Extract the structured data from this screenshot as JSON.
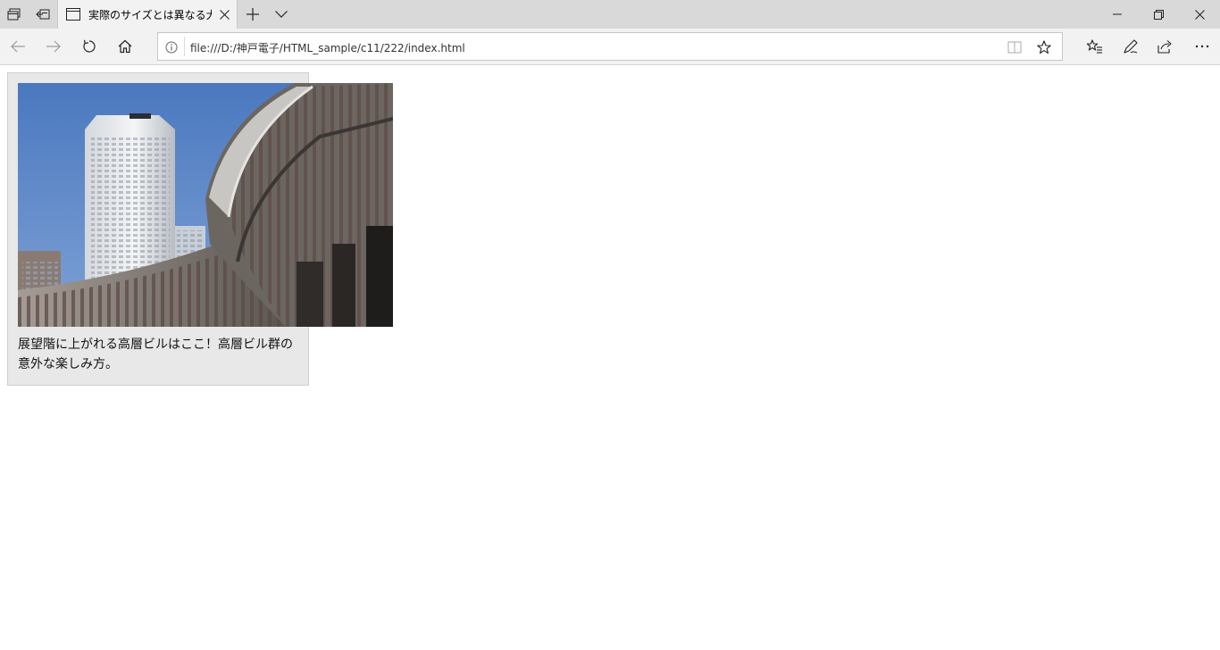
{
  "browser": {
    "tab": {
      "title": "実際のサイズとは異なる大"
    },
    "address": {
      "url": "file:///D:/神戸電子/HTML_sample/c11/222/index.html"
    },
    "icons": {
      "tab_manager": "tab-manager-icon",
      "set_aside": "set-aside-tabs-icon",
      "tab_page": "page-icon",
      "close_tab": "close-icon",
      "new_tab": "plus-icon",
      "tab_preview": "chevron-down-icon",
      "minimize": "minimize-icon",
      "restore": "restore-icon",
      "close_window": "close-icon",
      "back": "back-arrow-icon",
      "forward": "forward-arrow-icon",
      "refresh": "refresh-icon",
      "home": "home-icon",
      "info": "info-icon",
      "reading_view": "reading-view-icon",
      "favorite": "star-icon",
      "favorites_hub": "favorites-hub-icon",
      "notes": "pen-icon",
      "share": "share-icon",
      "more": "more-icon"
    }
  },
  "page": {
    "caption": "展望階に上がれる高層ビルはここ！高層ビル群の意外な楽しみ方。"
  }
}
